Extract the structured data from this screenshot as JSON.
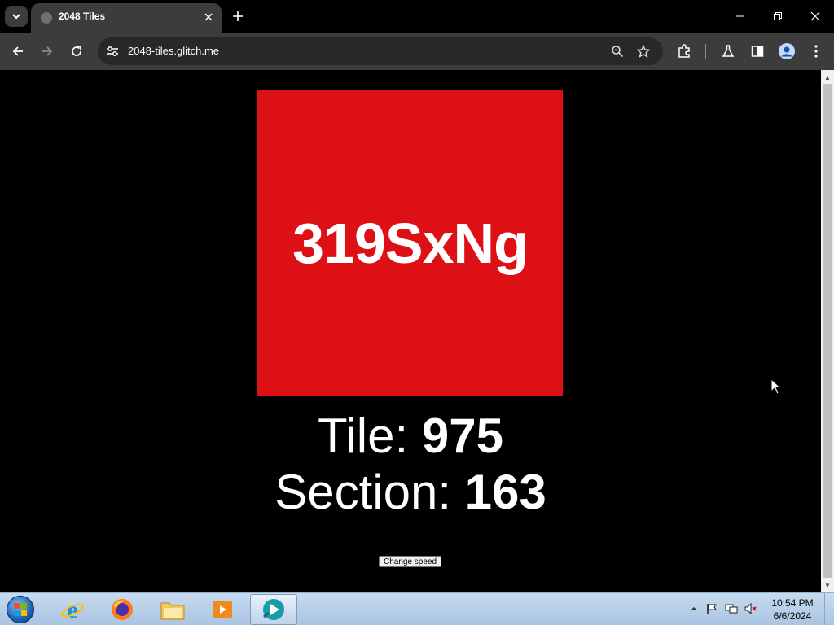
{
  "browser": {
    "tab_title": "2048 Tiles",
    "url": "2048-tiles.glitch.me"
  },
  "page": {
    "tile_code": "319SxNg",
    "tile_color": "#dd1015",
    "tile_label": "Tile: ",
    "tile_number": "975",
    "section_label": "Section: ",
    "section_number": "163",
    "change_speed_label": "Change speed"
  },
  "taskbar": {
    "items": [
      "start-orb",
      "internet-explorer-icon",
      "firefox-icon",
      "file-explorer-icon",
      "media-player-icon",
      "active-app-icon"
    ],
    "clock_time": "10:54 PM",
    "clock_date": "6/6/2024"
  }
}
